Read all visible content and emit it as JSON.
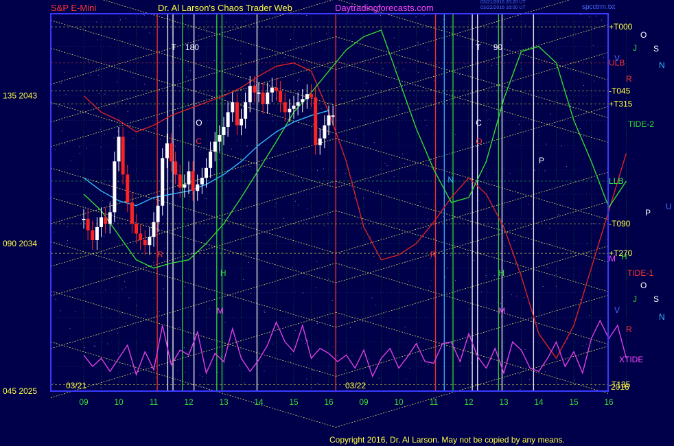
{
  "header": {
    "left": "S&P E-Mini",
    "center": "Dr. Al Larson's Chaos Trader Web",
    "site": "Daytradingforecasts.com",
    "stamp_line1": "03/21/2016 20:20 UT",
    "stamp_line2": "03/22/2016 16:00 UT",
    "right": "spcctrm.txt"
  },
  "footer": {
    "copyright": "Copyright 2016, Dr. Al Larson. May not be copied by any means."
  },
  "colors": {
    "background": "#00004a",
    "grid": "#00b000",
    "fans": "#ffff66",
    "price_up": "#ffffff",
    "price_down": "#ff2222",
    "xtide": "#e040e0",
    "line_green": "#33dd33",
    "line_red": "#dd2222",
    "line_cyan": "#33bbff"
  },
  "chart_data": {
    "type": "line",
    "title": "S&P E-Mini",
    "y_ticks": [
      {
        "label": "045  2025",
        "value": 2025
      },
      {
        "label": "090  2034",
        "value": 2034
      },
      {
        "label": "135  2043",
        "value": 2043
      }
    ],
    "ylim": [
      2025,
      2048
    ],
    "x_ticks_day1": [
      "09",
      "10",
      "11",
      "12",
      "13",
      "14",
      "15",
      "16"
    ],
    "x_ticks_day2": [
      "09",
      "10",
      "11",
      "12",
      "13",
      "14",
      "15",
      "16"
    ],
    "day_labels": [
      "03/21",
      "03/22"
    ],
    "year_label": "2016",
    "annotations_left": [
      "T",
      "180",
      "O",
      "C",
      "R",
      "H",
      "M"
    ],
    "annotations_right": [
      "T",
      "90",
      "C",
      "O",
      "N",
      "H",
      "M",
      "P",
      "R"
    ],
    "right_levels": [
      {
        "label": "+T000",
        "value": 2047.2,
        "color": "#ffff44"
      },
      {
        "label": "ULB",
        "value": 2045.0,
        "color": "#ff3333"
      },
      {
        "label": "-T045",
        "value": 2043.3,
        "color": "#ffff44"
      },
      {
        "label": "+T315",
        "value": 2042.5,
        "color": "#ffff44"
      },
      {
        "label": "LLB",
        "value": 2037.8,
        "color": "#44ff44"
      },
      {
        "label": "-T090",
        "value": 2035.2,
        "color": "#ffff44"
      },
      {
        "label": "+T270",
        "value": 2033.4,
        "color": "#ffff44"
      },
      {
        "label": "-T135",
        "value": 2025.4,
        "color": "#ffff44"
      }
    ],
    "planet_labels": [
      "O",
      "J",
      "S",
      "N",
      "V",
      "R",
      "TIDE-2",
      "U",
      "P",
      "M",
      "H",
      "TIDE-1",
      "O",
      "J",
      "S",
      "N",
      "V",
      "R",
      "XTIDE"
    ],
    "series": [
      {
        "name": "S&P E-Mini",
        "type": "candles",
        "x": [
          0.0,
          0.12,
          0.25,
          0.38,
          0.5,
          0.62,
          0.75,
          0.88,
          1.0,
          1.12,
          1.25,
          1.38,
          1.5,
          1.62,
          1.75,
          1.88,
          2.0,
          2.12,
          2.25,
          2.38,
          2.5,
          2.62,
          2.75,
          2.88,
          3.0,
          3.12,
          3.25,
          3.38,
          3.5,
          3.62,
          3.75,
          3.88,
          4.0,
          4.12,
          4.25,
          4.38,
          4.5,
          4.62,
          4.75,
          4.88,
          5.0,
          5.12,
          5.25,
          5.38,
          5.5,
          5.62,
          5.75,
          5.88,
          6.0,
          6.12,
          6.25,
          6.38,
          6.5,
          6.62,
          6.75,
          6.88,
          7.0,
          7.12
        ],
        "values": [
          2035.5,
          2034.8,
          2034.2,
          2035.0,
          2035.6,
          2035.2,
          2035.9,
          2039.0,
          2040.5,
          2038.2,
          2036.5,
          2035.2,
          2034.6,
          2034.2,
          2033.9,
          2034.4,
          2035.3,
          2036.3,
          2039.2,
          2040.1,
          2039.0,
          2038.2,
          2037.4,
          2037.6,
          2038.4,
          2037.2,
          2037.6,
          2038.0,
          2038.6,
          2039.6,
          2040.2,
          2040.6,
          2041.1,
          2042.0,
          2042.6,
          2041.2,
          2041.6,
          2042.6,
          2043.6,
          2043.2,
          2043.2,
          2042.5,
          2043.2,
          2043.5,
          2043.3,
          2042.6,
          2042.0,
          2042.2,
          2042.4,
          2042.6,
          2042.8,
          2043.1,
          2042.9,
          2040.0,
          2040.4,
          2041.2,
          2041.8,
          2041.8
        ]
      },
      {
        "name": "red forecast",
        "color": "#dd2222",
        "x": [
          0,
          0.5,
          1,
          1.5,
          2,
          2.5,
          3,
          3.5,
          4,
          4.5,
          5,
          5.5,
          6,
          6.5,
          7,
          7.5,
          8,
          8.5,
          9,
          9.5,
          10,
          10.5,
          11,
          11.5,
          12,
          12.5,
          13,
          13.5,
          14,
          14.5,
          15,
          15.5
        ],
        "values": [
          2043.0,
          2042.0,
          2041.5,
          2040.8,
          2041.2,
          2041.8,
          2042.2,
          2042.6,
          2043.0,
          2043.5,
          2044.2,
          2044.8,
          2045.0,
          2044.5,
          2042.0,
          2039.0,
          2035.0,
          2033.0,
          2033.3,
          2034.0,
          2035.3,
          2036.8,
          2038.0,
          2037.0,
          2035.0,
          2032.0,
          2028.5,
          2027.0,
          2029.0,
          2032.5,
          2036.0,
          2039.5
        ]
      },
      {
        "name": "green forecast",
        "color": "#33dd33",
        "x": [
          0,
          0.5,
          1,
          1.5,
          2,
          2.5,
          3,
          3.5,
          4,
          4.5,
          5,
          5.5,
          6,
          6.5,
          7,
          7.5,
          8,
          8.5,
          9,
          9.5,
          10,
          10.5,
          11,
          11.5,
          12,
          12.5,
          13,
          13.5,
          14,
          14.5,
          15,
          15.5
        ],
        "values": [
          2037.0,
          2036.0,
          2034.5,
          2033.0,
          2032.5,
          2032.8,
          2033.0,
          2034.0,
          2035.2,
          2036.8,
          2038.5,
          2040.2,
          2042.0,
          2043.2,
          2044.5,
          2045.8,
          2046.6,
          2047.0,
          2044.0,
          2041.0,
          2038.5,
          2036.5,
          2036.8,
          2039.0,
          2042.8,
          2045.7,
          2046.0,
          2045.0,
          2041.5,
          2039.0,
          2036.2,
          2037.8
        ]
      },
      {
        "name": "cyan forecast",
        "color": "#33bbff",
        "x": [
          0,
          0.5,
          1,
          1.5,
          2,
          2.5,
          3,
          3.5,
          4,
          4.5,
          5,
          5.5,
          6,
          6.5,
          7
        ],
        "values": [
          2038.0,
          2037.2,
          2036.6,
          2036.3,
          2036.8,
          2037.0,
          2037.2,
          2037.6,
          2038.2,
          2039.0,
          2040.0,
          2040.8,
          2041.4,
          2041.8,
          2042.1
        ]
      },
      {
        "name": "XTIDE",
        "color": "#e040e0",
        "x": [
          0,
          0.25,
          0.5,
          0.75,
          1,
          1.25,
          1.5,
          1.75,
          2,
          2.25,
          2.5,
          2.75,
          3,
          3.25,
          3.5,
          3.75,
          4,
          4.25,
          4.5,
          4.75,
          5,
          5.25,
          5.5,
          5.75,
          6,
          6.25,
          6.5,
          6.75,
          7,
          7.25,
          7.5,
          7.75,
          8,
          8.25,
          8.5,
          8.75,
          9,
          9.25,
          9.5,
          9.75,
          10,
          10.25,
          10.5,
          10.75,
          11,
          11.25,
          11.5,
          11.75,
          12,
          12.25,
          12.5,
          12.75,
          13,
          13.25,
          13.5,
          13.75,
          14,
          14.25,
          14.5,
          14.75,
          15,
          15.25,
          15.5
        ],
        "values": [
          2027.2,
          2026.5,
          2027.0,
          2026.2,
          2027.0,
          2027.8,
          2026.0,
          2027.4,
          2026.3,
          2029.0,
          2026.6,
          2027.5,
          2027.2,
          2028.6,
          2026.1,
          2027.3,
          2026.8,
          2028.8,
          2027.0,
          2026.2,
          2026.9,
          2027.8,
          2029.2,
          2028.0,
          2027.4,
          2029.0,
          2027.0,
          2027.6,
          2027.3,
          2026.8,
          2027.2,
          2026.4,
          2027.5,
          2025.9,
          2027.0,
          2027.6,
          2026.4,
          2027.1,
          2027.9,
          2026.8,
          2026.7,
          2027.9,
          2028.0,
          2026.8,
          2028.5,
          2027.1,
          2026.4,
          2027.6,
          2026.1,
          2028.0,
          2027.5,
          2026.4,
          2026.2,
          2027.0,
          2028.0,
          2026.5,
          2027.4,
          2026.1,
          2028.2,
          2029.3,
          2028.2,
          2029.0,
          2027.0
        ]
      }
    ],
    "grid": true,
    "legend": "none"
  }
}
